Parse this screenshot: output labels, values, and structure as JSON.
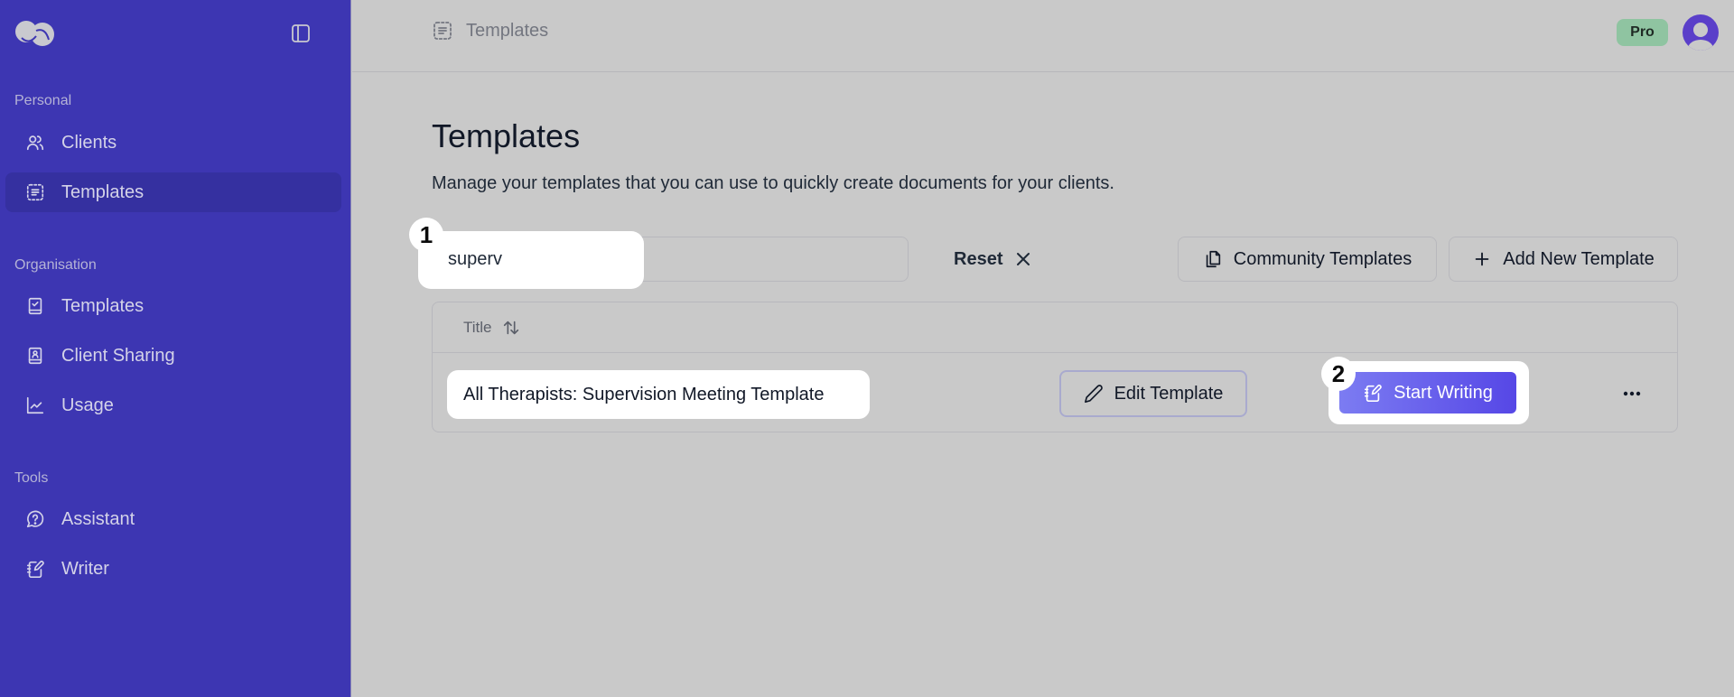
{
  "sidebar": {
    "logo_icon": "brand-logo",
    "collapse_icon": "sidebar-toggle-icon",
    "sections": [
      {
        "label": "Personal",
        "items": [
          {
            "label": "Clients",
            "icon": "users-icon",
            "active": false
          },
          {
            "label": "Templates",
            "icon": "list-dashed-icon",
            "active": true
          }
        ]
      },
      {
        "label": "Organisation",
        "items": [
          {
            "label": "Templates",
            "icon": "book-check-icon",
            "active": false
          },
          {
            "label": "Client Sharing",
            "icon": "book-user-icon",
            "active": false
          },
          {
            "label": "Usage",
            "icon": "line-chart-icon",
            "active": false
          }
        ]
      },
      {
        "label": "Tools",
        "items": [
          {
            "label": "Assistant",
            "icon": "message-question-icon",
            "active": false
          },
          {
            "label": "Writer",
            "icon": "notebook-pen-icon",
            "active": false
          }
        ]
      }
    ]
  },
  "header": {
    "breadcrumb": "Templates",
    "plan_badge": "Pro",
    "plan_badge_color": "#8fc4a1",
    "avatar_color": "#5a3fc9"
  },
  "main": {
    "title": "Templates",
    "description": "Manage your templates that you can use to quickly create documents for your clients.",
    "search": {
      "value": "superv",
      "placeholder": ""
    },
    "reset_label": "Reset",
    "community_templates_label": "Community Templates",
    "add_template_label": "Add New Template",
    "table": {
      "columns": [
        {
          "label": "Title",
          "sortable": true
        }
      ],
      "rows": [
        {
          "title": "All Therapists: Supervision Meeting Template",
          "edit_label": "Edit Template",
          "start_label": "Start Writing"
        }
      ]
    },
    "annotations": [
      "1",
      "2"
    ]
  },
  "colors": {
    "sidebar_bg": "#3d36b2",
    "sidebar_active": "#3530a0",
    "page_bg": "#c9c9c9",
    "primary_gradient_start": "#7c7cf2",
    "primary_gradient_end": "#5647e6"
  }
}
